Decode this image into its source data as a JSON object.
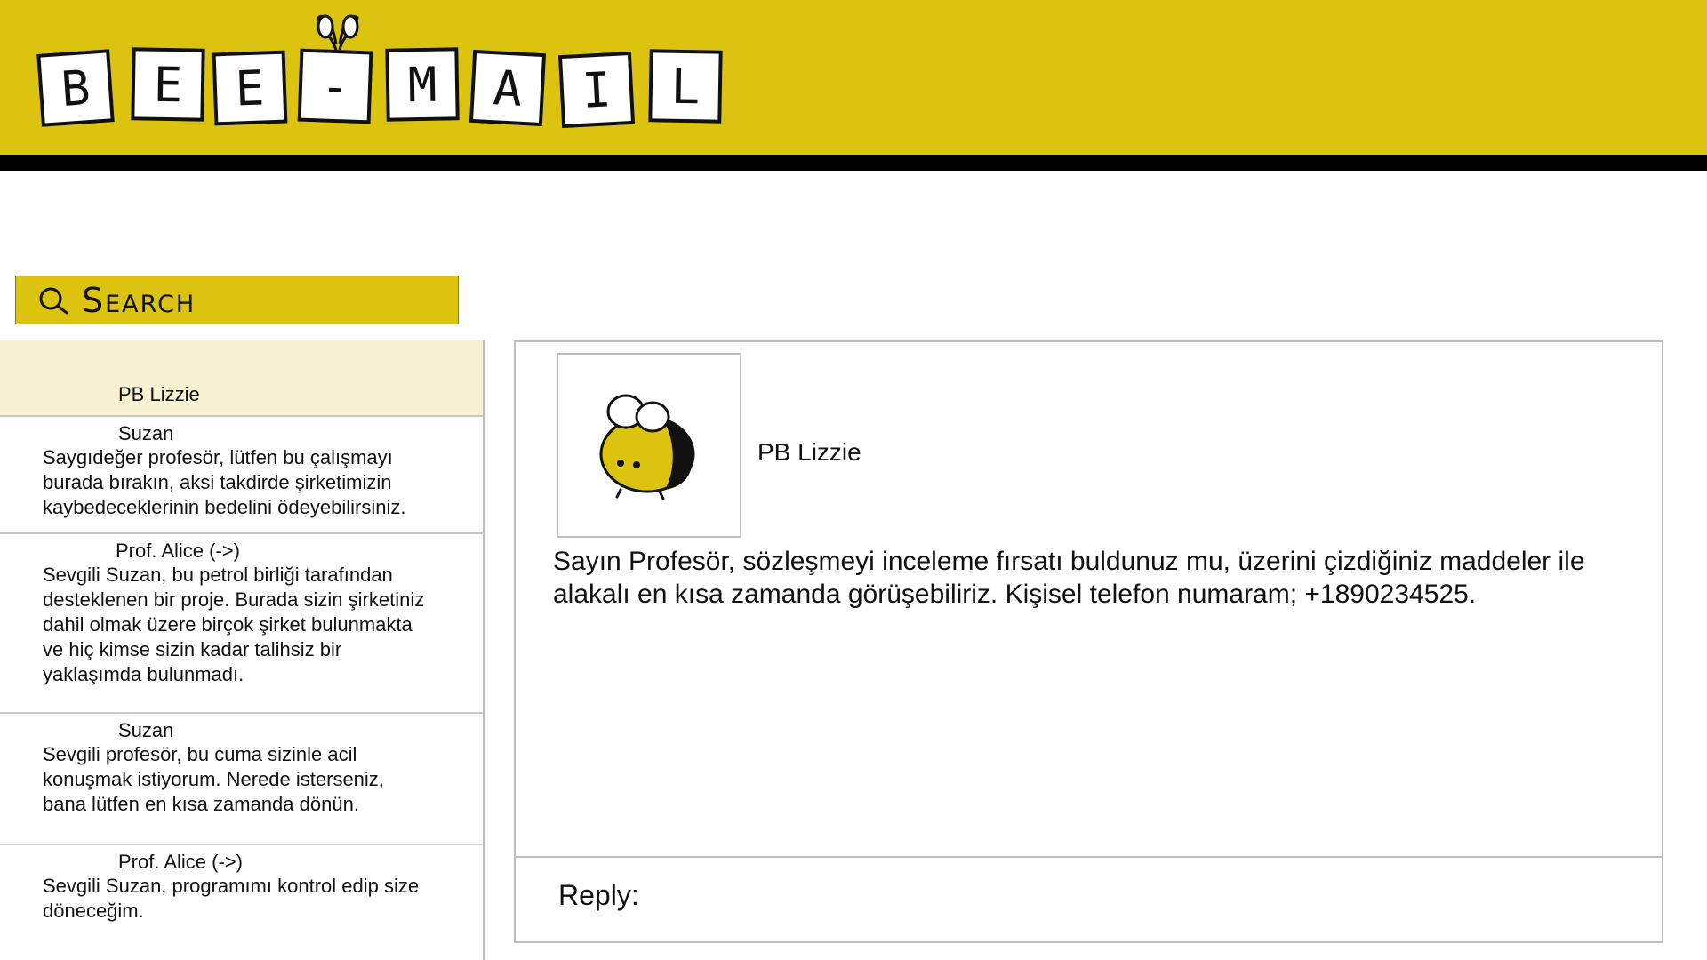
{
  "app": {
    "logo_letters": [
      "B",
      "E",
      "E",
      "-",
      "M",
      "A",
      "I",
      "L"
    ],
    "brand_color": "#dcc30f"
  },
  "search": {
    "label": "Search",
    "icon": "search-icon"
  },
  "messages": [
    {
      "sender": "PB Lizzie",
      "snippet": "",
      "selected": true
    },
    {
      "sender": "Suzan",
      "snippet": "Saygıdeğer profesör, lütfen bu çalışmayı\nburada bırakın, aksi takdirde şirketimizin\nkaybedeceklerinin bedelini ödeyebilirsiniz."
    },
    {
      "sender": "Prof. Alice (->)",
      "snippet": "Sevgili Suzan, bu petrol birliği tarafından\ndesteklenen bir proje. Burada sizin şirketiniz\ndahil olmak üzere birçok şirket bulunmakta\nve hiç kimse sizin kadar talihsiz bir\nyaklaşımda bulunmadı."
    },
    {
      "sender": "Suzan",
      "snippet": "Sevgili profesör, bu cuma sizinle acil\nkonuşmak istiyorum. Nerede isterseniz,\nbana lütfen en kısa zamanda dönün."
    },
    {
      "sender": "Prof. Alice (->)",
      "snippet": "Sevgili Suzan, programımı kontrol edip size\ndöneceğim."
    }
  ],
  "reader": {
    "avatar_icon": "bee-icon",
    "sender": "PB Lizzie",
    "body": "Sayın Profesör, sözleşmeyi inceleme fırsatı buldunuz mu, üzerini çizdiğiniz maddeler ile alakalı en kısa zamanda görüşebiliriz. Kişisel telefon numaram; +1890234525.",
    "reply_label": "Reply:"
  }
}
